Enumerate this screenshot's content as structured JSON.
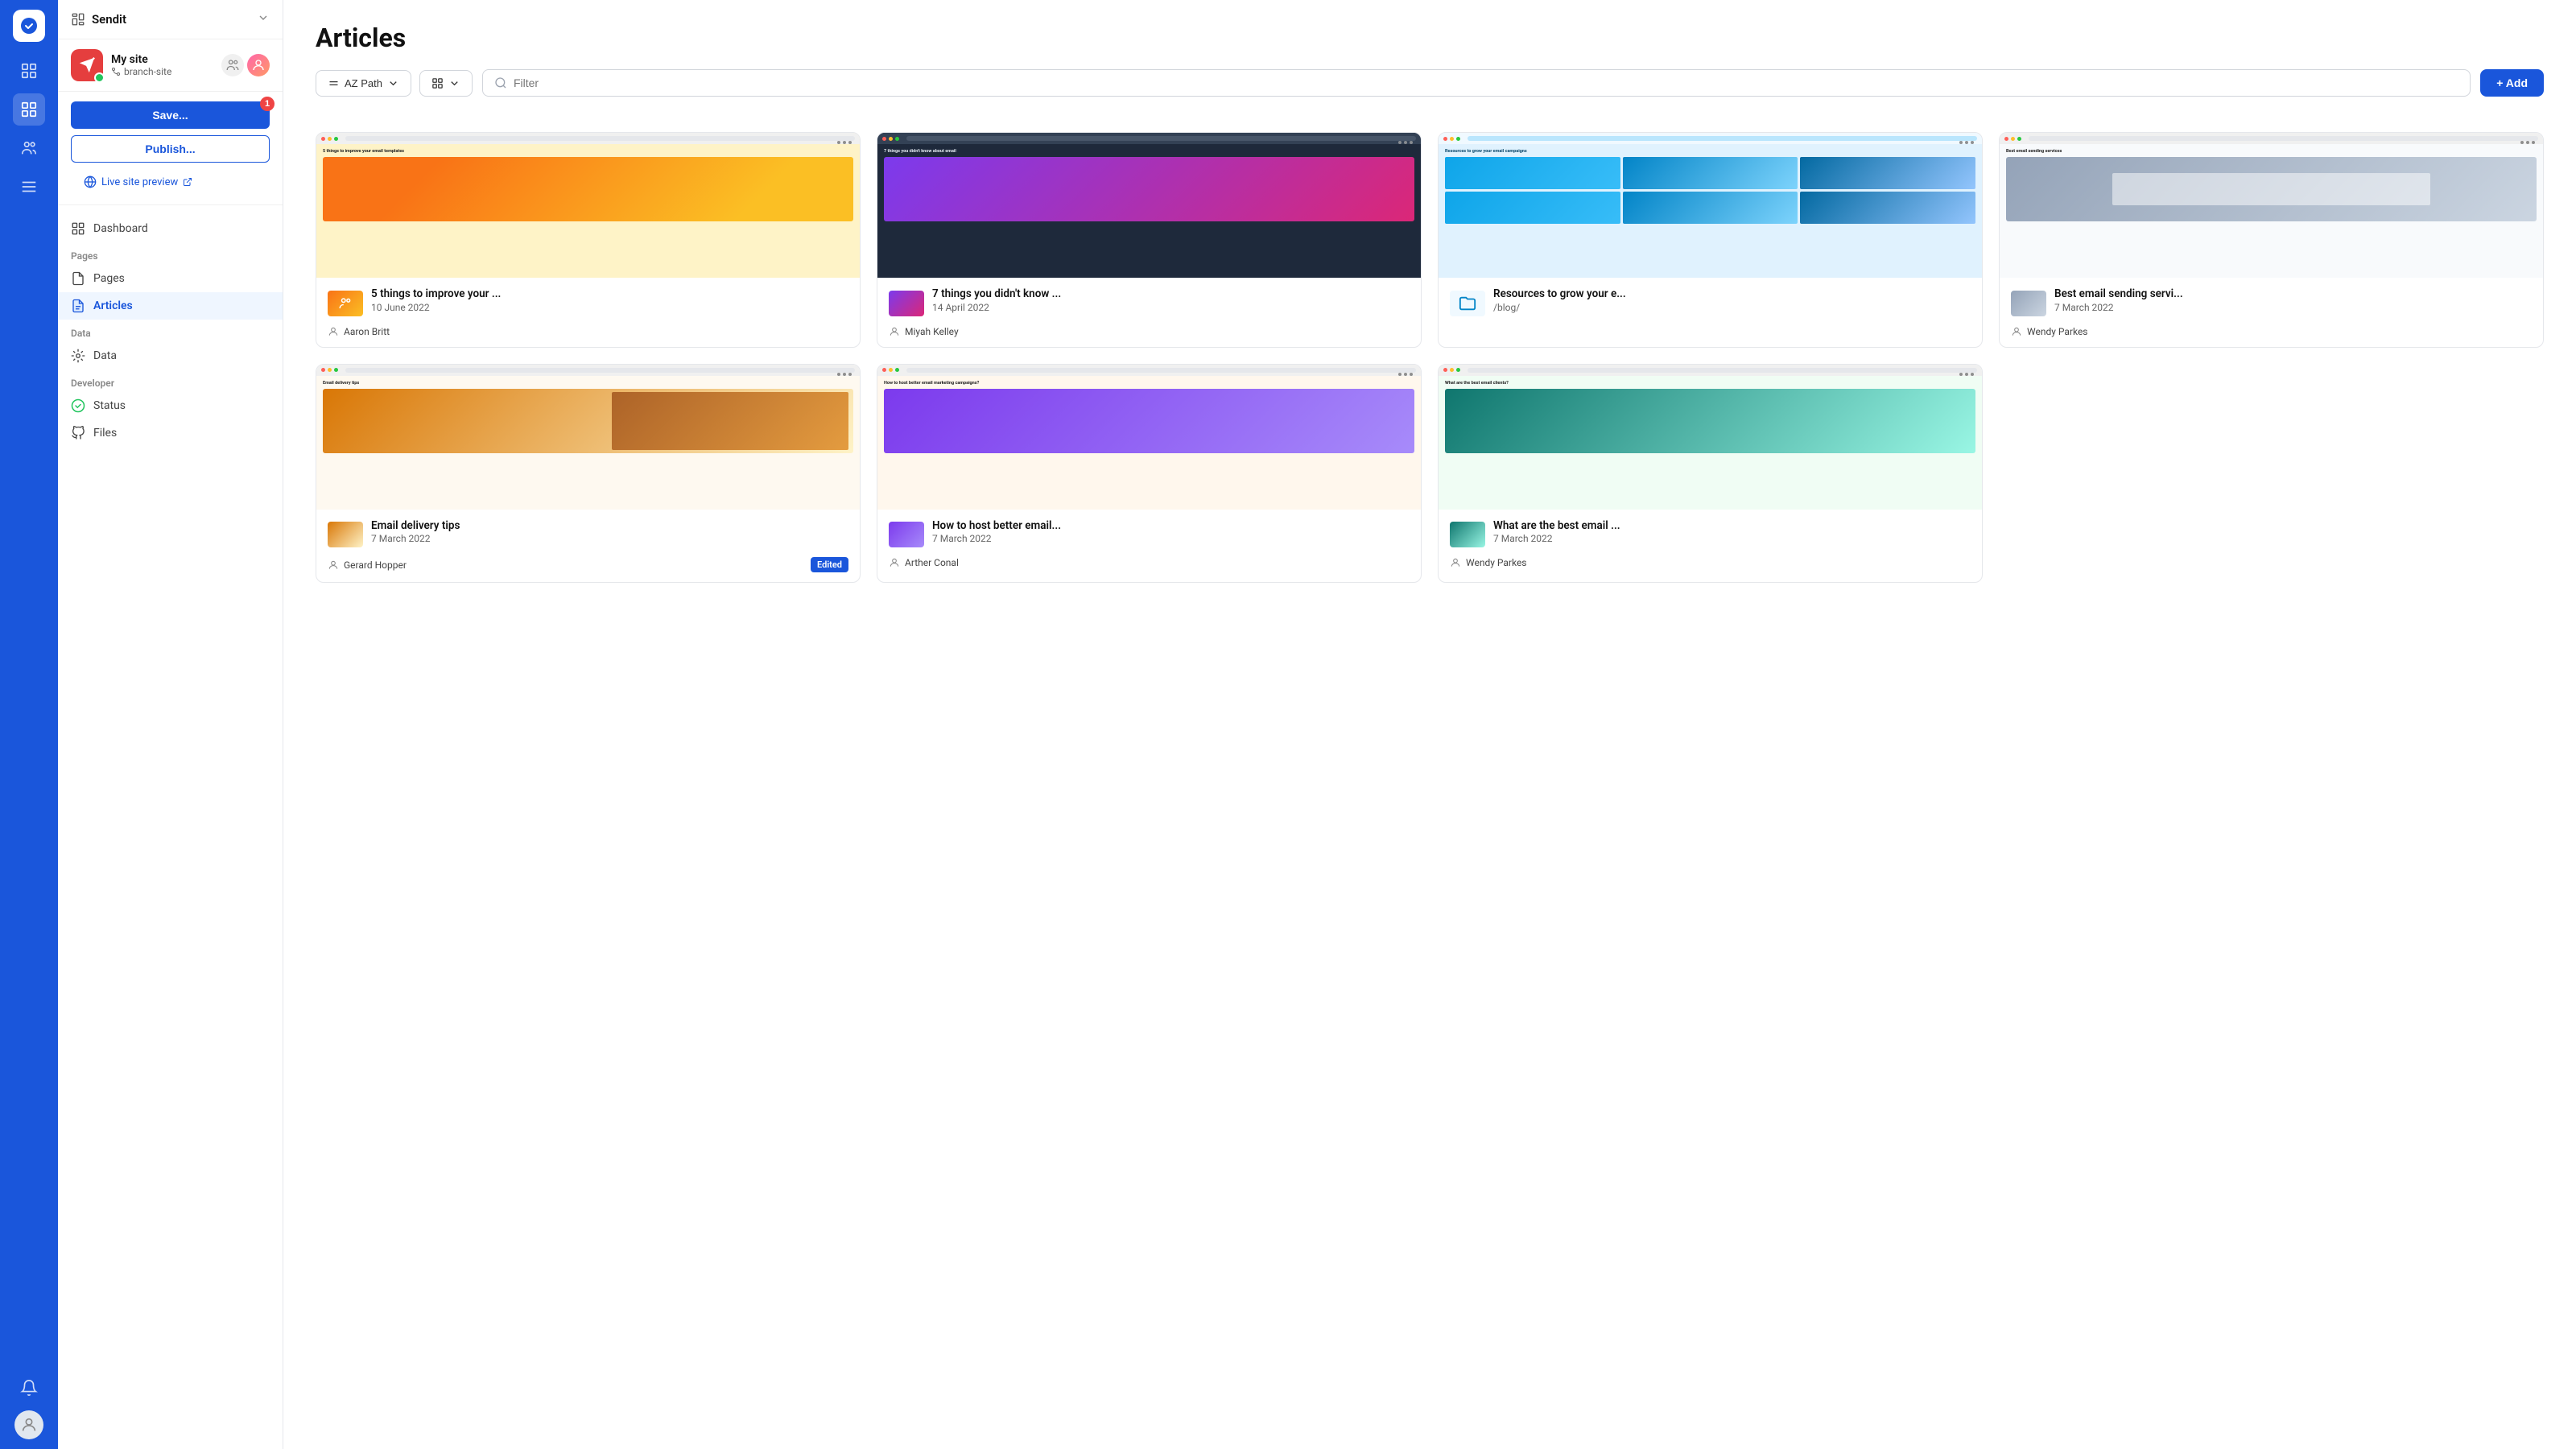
{
  "app": {
    "name": "Sendit"
  },
  "site": {
    "name": "My site",
    "branch": "branch-site",
    "status": "live"
  },
  "sidebar": {
    "save_label": "Save...",
    "save_badge": "1",
    "publish_label": "Publish...",
    "live_preview_label": "Live site preview",
    "nav_sections": [
      {
        "label": "",
        "items": [
          {
            "id": "dashboard",
            "label": "Dashboard",
            "icon": "chart-bar"
          }
        ]
      },
      {
        "label": "Pages",
        "items": [
          {
            "id": "pages",
            "label": "Pages",
            "icon": "file"
          },
          {
            "id": "articles",
            "label": "Articles",
            "icon": "document-text",
            "active": true
          }
        ]
      },
      {
        "label": "Data",
        "items": [
          {
            "id": "data",
            "label": "Data",
            "icon": "cog"
          }
        ]
      },
      {
        "label": "Developer",
        "items": [
          {
            "id": "status",
            "label": "Status",
            "icon": "check-circle"
          },
          {
            "id": "files",
            "label": "Files",
            "icon": "github"
          }
        ]
      }
    ]
  },
  "main": {
    "title": "Articles",
    "toolbar": {
      "sort_label": "AZ Path",
      "filter_placeholder": "Filter",
      "add_label": "+ Add"
    },
    "articles": [
      {
        "id": "1",
        "title": "5 things to improve your ...",
        "date": "10 June 2022",
        "author": "Aaron Britt",
        "thumbnail_type": "img-fill-1",
        "preview_title": "5 things to improve your email templates",
        "edited": false
      },
      {
        "id": "2",
        "title": "7 things you didn't know ...",
        "date": "14 April 2022",
        "author": "Miyah Kelley",
        "thumbnail_type": "img-fill-2",
        "preview_title": "7 things you didn't know about email",
        "edited": false
      },
      {
        "id": "3",
        "title": "Resources to grow your e...",
        "date": "/blog/",
        "author": "",
        "thumbnail_type": "img-fill-3",
        "preview_title": "Resources to grow your email campaigns",
        "edited": false,
        "is_folder": true,
        "folder_path": "/blog/"
      },
      {
        "id": "4",
        "title": "Best email sending servi...",
        "date": "7 March 2022",
        "author": "Wendy Parkes",
        "thumbnail_type": "img-fill-4",
        "preview_title": "Best email sending services",
        "edited": false
      },
      {
        "id": "5",
        "title": "Email delivery tips",
        "date": "7 March 2022",
        "author": "Gerard Hopper",
        "thumbnail_type": "img-fill-5",
        "preview_title": "Email delivery tips",
        "edited": true
      },
      {
        "id": "6",
        "title": "How to host better email...",
        "date": "7 March 2022",
        "author": "Arther Conal",
        "thumbnail_type": "img-fill-6",
        "preview_title": "How to host better email marketing campaigns?",
        "edited": false
      },
      {
        "id": "7",
        "title": "What are the best email ...",
        "date": "7 March 2022",
        "author": "Wendy Parkes",
        "thumbnail_type": "img-fill-7",
        "preview_title": "What are the best email clients?",
        "edited": false
      }
    ]
  }
}
